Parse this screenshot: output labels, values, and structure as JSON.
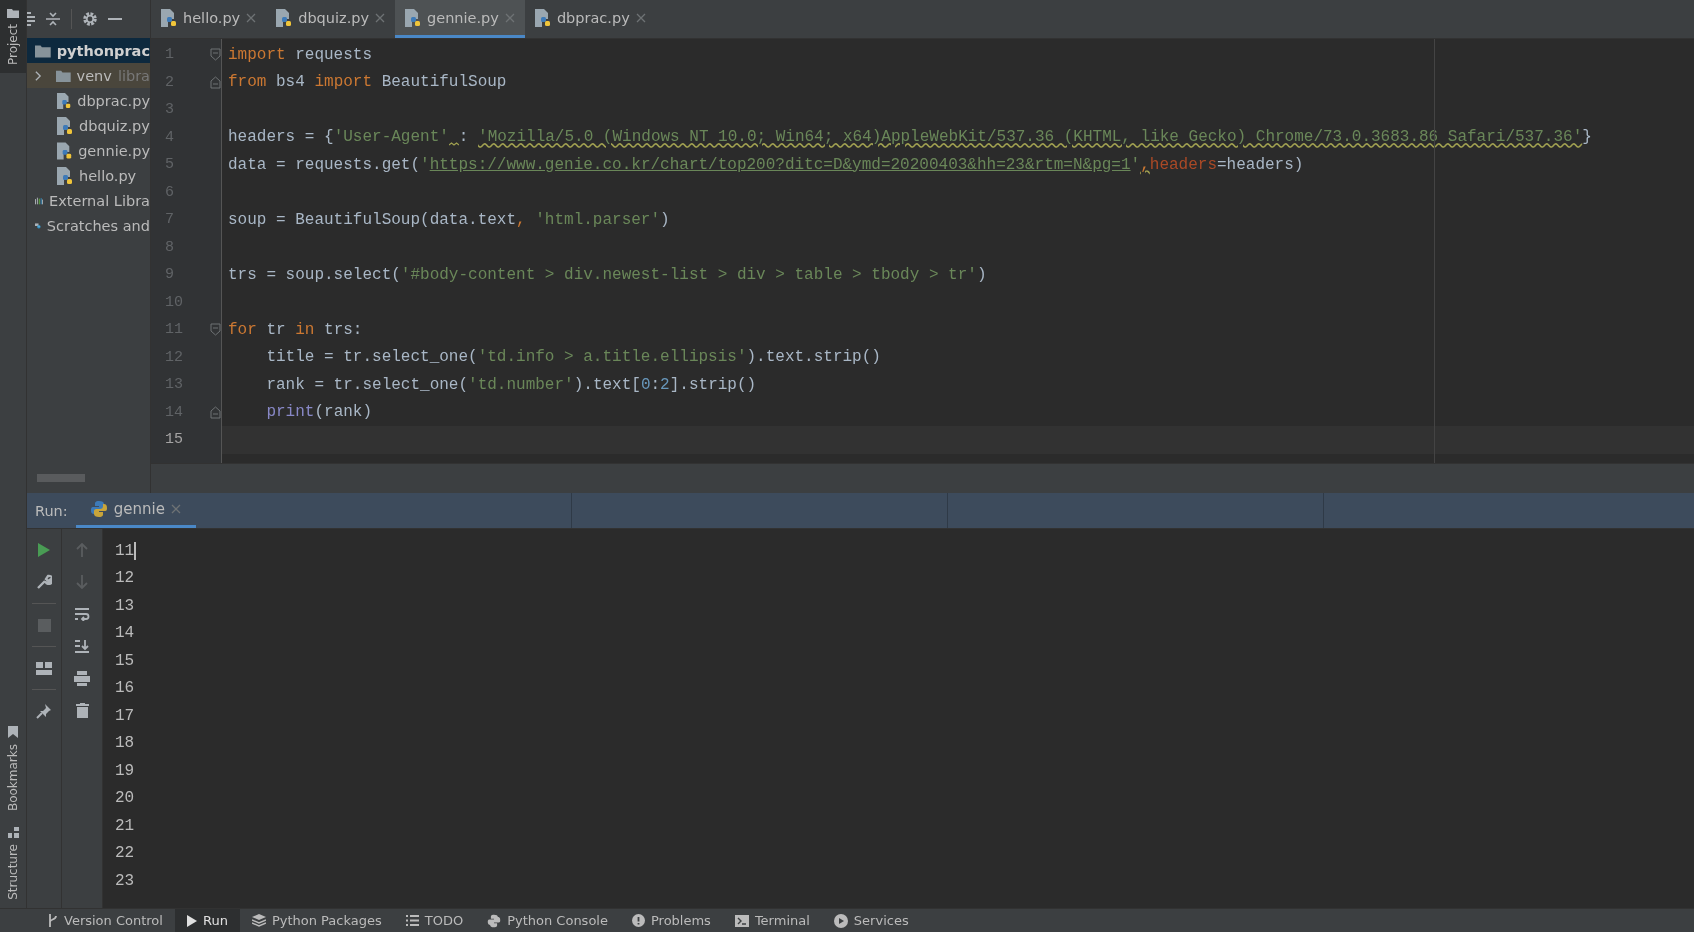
{
  "left_stripe": [
    {
      "label": "Project",
      "selected": true,
      "kind": "folder"
    },
    {
      "label": "Bookmarks",
      "selected": false,
      "kind": "bookmark"
    },
    {
      "label": "Structure",
      "selected": false,
      "kind": "structure"
    }
  ],
  "project_tree": [
    {
      "label": "pythonprac",
      "selected": true,
      "kind": "module",
      "children": [
        {
          "label": "venv",
          "note": "libra",
          "kind": "excluded",
          "expanded": false,
          "selected": false
        },
        {
          "label": "dbprac.py",
          "kind": "py",
          "selected": false
        },
        {
          "label": "dbquiz.py",
          "kind": "py",
          "selected": false
        },
        {
          "label": "gennie.py",
          "kind": "py",
          "selected": false
        },
        {
          "label": "hello.py",
          "kind": "py",
          "selected": false
        }
      ]
    },
    {
      "label": "External Libra",
      "kind": "libs",
      "selected": false
    },
    {
      "label": "Scratches and",
      "kind": "scratch",
      "selected": false
    }
  ],
  "tabs": [
    {
      "label": "hello.py",
      "selected": false
    },
    {
      "label": "dbquiz.py",
      "selected": false
    },
    {
      "label": "gennie.py",
      "selected": true
    },
    {
      "label": "dbprac.py",
      "selected": false
    }
  ],
  "editor": {
    "lines": [
      {
        "n": "1",
        "current": false,
        "fold_start": true,
        "indented": false,
        "tokens": [
          {
            "t": "import",
            "kind": "kw"
          },
          {
            "t": " requests",
            "kind": "p"
          }
        ]
      },
      {
        "n": "2",
        "current": false,
        "fold_end": true,
        "indented": false,
        "tokens": [
          {
            "t": "from",
            "kind": "kw"
          },
          {
            "t": " bs4 ",
            "kind": "p"
          },
          {
            "t": "import",
            "kind": "kw"
          },
          {
            "t": " BeautifulSoup",
            "kind": "p"
          }
        ]
      },
      {
        "n": "3",
        "current": false
      },
      {
        "n": "4",
        "current": false,
        "indented": false,
        "tokens": [
          {
            "t": "headers = {",
            "kind": "p"
          },
          {
            "t": "'User-Agent'",
            "kind": "str",
            "warn_after": true
          },
          {
            "t": ": ",
            "kind": "p"
          },
          {
            "t": "'Mozilla/5.0 (Windows NT 10.0; Win64; x64)AppleWebKit/537.36 (KHTML, like Gecko) Chrome/73.0.3683.86 Safari/537.36'",
            "kind": "strwarn"
          },
          {
            "t": "}",
            "kind": "p"
          }
        ]
      },
      {
        "n": "5",
        "current": false,
        "indented": false,
        "tokens": [
          {
            "t": "data = requests.get(",
            "kind": "p"
          },
          {
            "t": "'",
            "kind": "str"
          },
          {
            "t": "https://www.genie.co.kr/chart/top200?ditc=D&ymd=20200403&hh=23&rtm=N&pg=1",
            "kind": "url"
          },
          {
            "t": "'",
            "kind": "str"
          },
          {
            "t": ",",
            "kind": "kwwarn"
          },
          {
            "t": "headers",
            "kind": "param"
          },
          {
            "t": "=headers)",
            "kind": "p"
          }
        ]
      },
      {
        "n": "6",
        "current": false
      },
      {
        "n": "7",
        "current": false,
        "indented": false,
        "tokens": [
          {
            "t": "soup = BeautifulSoup(data.text",
            "kind": "p"
          },
          {
            "t": ", ",
            "kind": "kw"
          },
          {
            "t": "'html.parser'",
            "kind": "str"
          },
          {
            "t": ")",
            "kind": "p"
          }
        ]
      },
      {
        "n": "8",
        "current": false
      },
      {
        "n": "9",
        "current": false,
        "indented": false,
        "tokens": [
          {
            "t": "trs = soup.select(",
            "kind": "p"
          },
          {
            "t": "'#body-content > div.newest-list > div > table > tbody > tr'",
            "kind": "str"
          },
          {
            "t": ")",
            "kind": "p"
          }
        ]
      },
      {
        "n": "10",
        "current": false
      },
      {
        "n": "11",
        "current": false,
        "fold_start": true,
        "indented": false,
        "tokens": [
          {
            "t": "for",
            "kind": "kw"
          },
          {
            "t": " tr ",
            "kind": "p"
          },
          {
            "t": "in",
            "kind": "kw"
          },
          {
            "t": " trs:",
            "kind": "p"
          }
        ]
      },
      {
        "n": "12",
        "current": false,
        "indented": true,
        "tokens": [
          {
            "t": "title = tr.select_one(",
            "kind": "p"
          },
          {
            "t": "'td.info > a.title.ellipsis'",
            "kind": "str"
          },
          {
            "t": ").text.strip()",
            "kind": "p"
          }
        ]
      },
      {
        "n": "13",
        "current": false,
        "indented": true,
        "tokens": [
          {
            "t": "rank = tr.select_one(",
            "kind": "p"
          },
          {
            "t": "'td.number'",
            "kind": "str"
          },
          {
            "t": ").text[",
            "kind": "p"
          },
          {
            "t": "0",
            "kind": "num"
          },
          {
            "t": ":",
            "kind": "p"
          },
          {
            "t": "2",
            "kind": "num"
          },
          {
            "t": "].strip()",
            "kind": "p"
          }
        ]
      },
      {
        "n": "14",
        "current": false,
        "fold_end": true,
        "indented": true,
        "tokens": [
          {
            "t": "print",
            "kind": "builtin"
          },
          {
            "t": "(rank)",
            "kind": "p"
          }
        ]
      },
      {
        "n": "15",
        "current": true
      }
    ]
  },
  "run_panel": {
    "label": "Run:",
    "tabs": [
      {
        "label": "gennie",
        "selected": true
      }
    ],
    "toolbar_left": [
      {
        "kind": "rerun",
        "disabled": false
      },
      {
        "kind": "settings",
        "disabled": false
      },
      {
        "kind": "stop",
        "disabled": true
      },
      {
        "kind": "layout",
        "disabled": false
      },
      {
        "kind": "pin",
        "disabled": false
      }
    ],
    "toolbar_right": [
      {
        "kind": "up",
        "disabled": true
      },
      {
        "kind": "down",
        "disabled": true
      },
      {
        "kind": "wrap",
        "disabled": false
      },
      {
        "kind": "scroll-end",
        "disabled": false
      },
      {
        "kind": "print",
        "disabled": false
      },
      {
        "kind": "trash",
        "disabled": false
      }
    ],
    "output": [
      "11",
      "12",
      "13",
      "14",
      "15",
      "16",
      "17",
      "18",
      "19",
      "20",
      "21",
      "22",
      "23"
    ]
  },
  "bottom_bar": [
    {
      "label": "Version Control",
      "kind": "vcs",
      "selected": false
    },
    {
      "label": "Run",
      "kind": "run",
      "selected": true
    },
    {
      "label": "Python Packages",
      "kind": "packages",
      "selected": false
    },
    {
      "label": "TODO",
      "kind": "todo",
      "selected": false
    },
    {
      "label": "Python Console",
      "kind": "python",
      "selected": false
    },
    {
      "label": "Problems",
      "kind": "problems",
      "selected": false
    },
    {
      "label": "Terminal",
      "kind": "terminal",
      "selected": false
    },
    {
      "label": "Services",
      "kind": "services",
      "selected": false
    }
  ]
}
